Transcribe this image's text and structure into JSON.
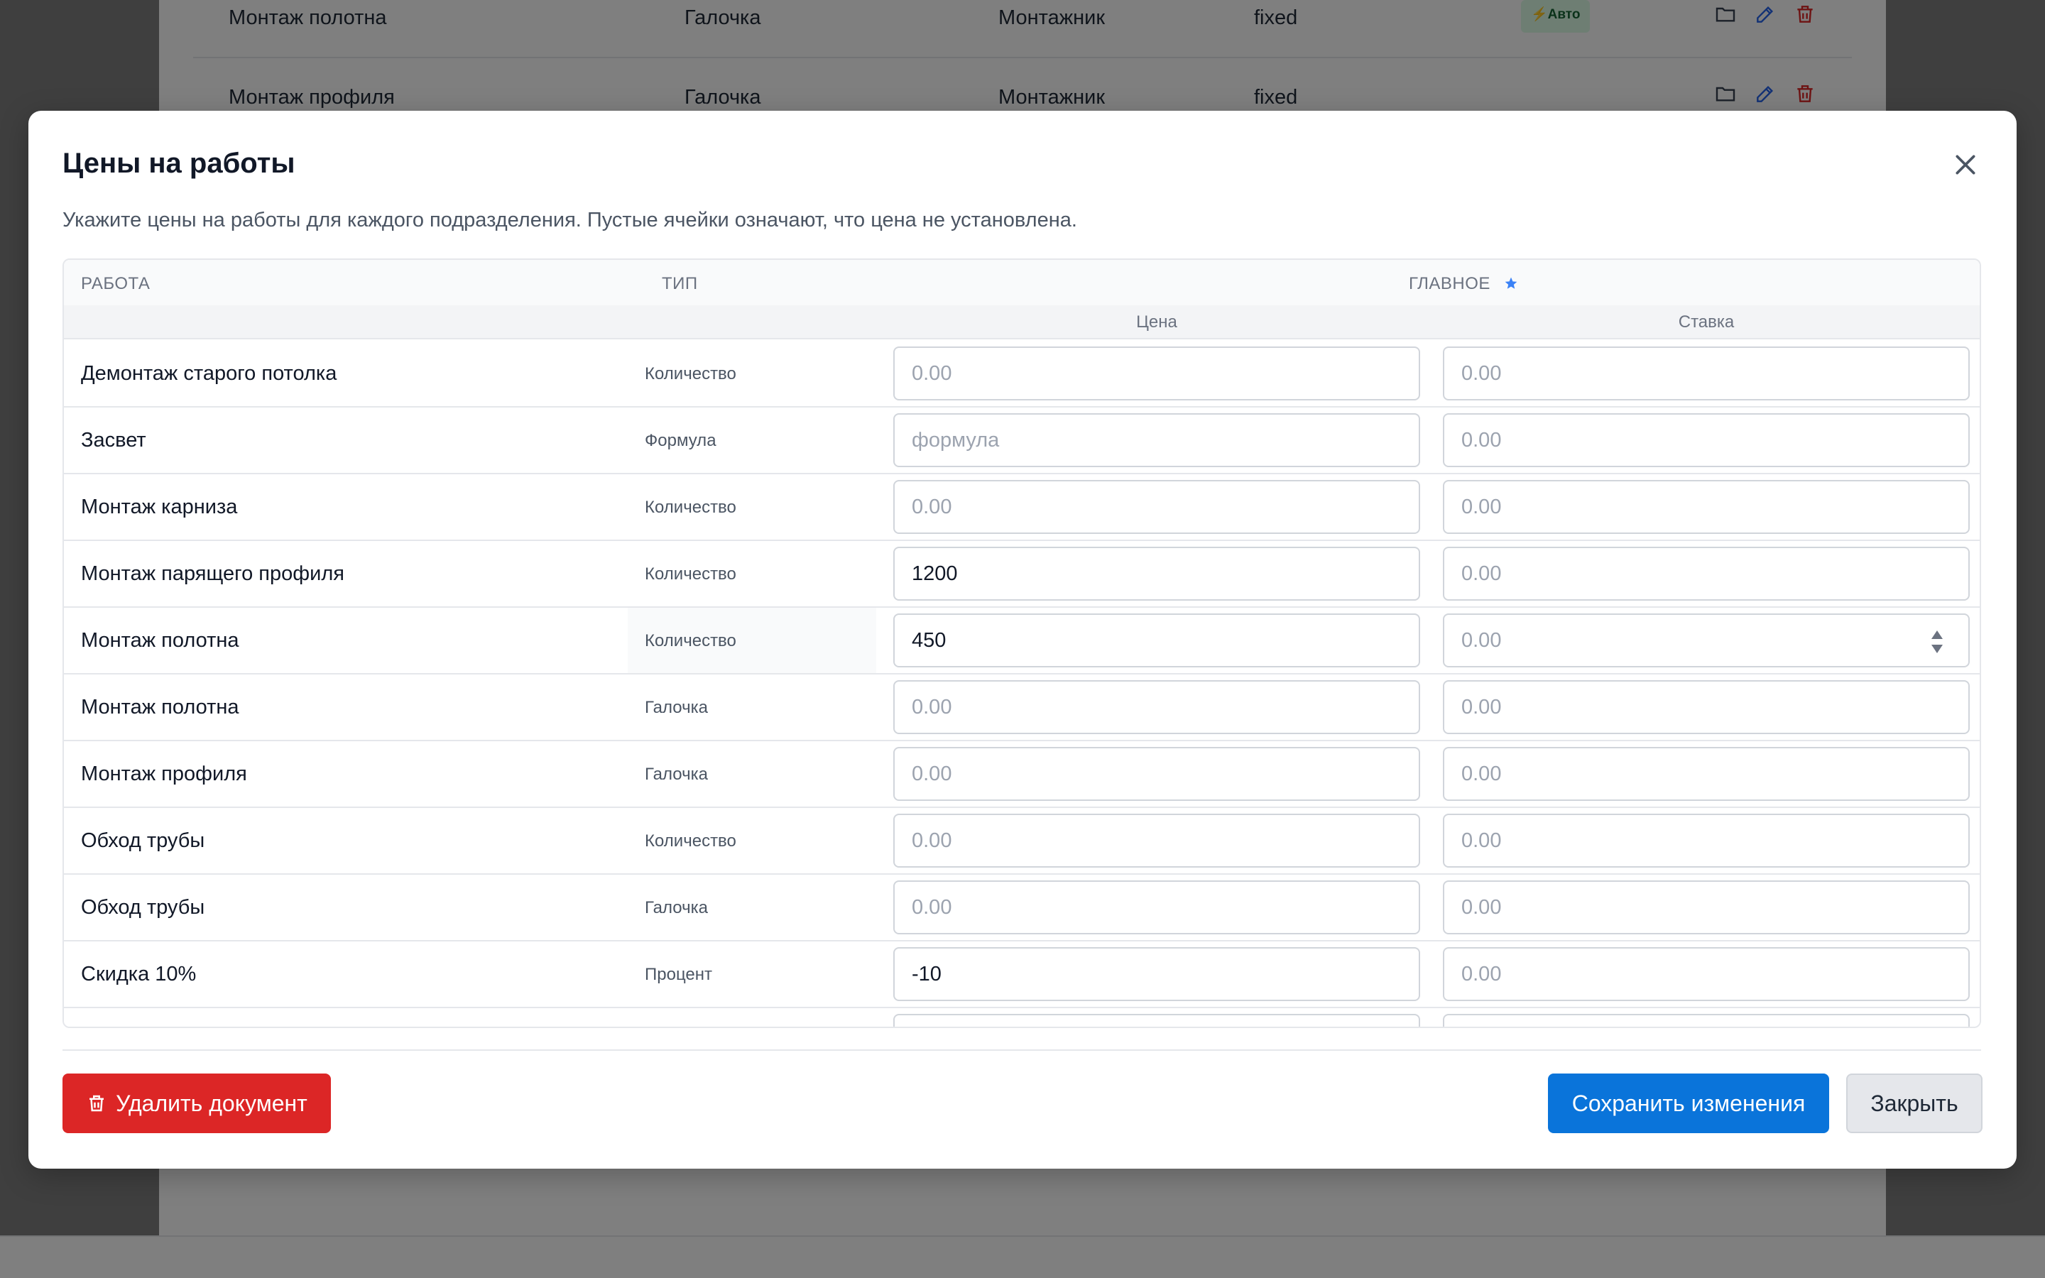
{
  "background_table": {
    "rows": [
      {
        "name": "Монтаж полотна",
        "type": "Галочка",
        "role": "Монтажник",
        "mode": "fixed",
        "badge": "⚡Авто"
      },
      {
        "name": "Монтаж профиля",
        "type": "Галочка",
        "role": "Монтажник",
        "mode": "fixed",
        "badge": ""
      }
    ]
  },
  "modal": {
    "title": "Цены на работы",
    "description": "Укажите цены на работы для каждого подразделения. Пустые ячейки означают, что цена не установлена.",
    "close_icon": "close-icon"
  },
  "table": {
    "headers": {
      "work": "РАБОТА",
      "type": "ТИП",
      "division": "ГЛАВНОЕ",
      "division_icon": "star-icon",
      "price": "Цена",
      "rate": "Ставка"
    },
    "rows": [
      {
        "name": "Демонтаж старого потолка",
        "type": "Количество",
        "price": "",
        "price_placeholder": "0.00",
        "rate": "",
        "rate_placeholder": "0.00"
      },
      {
        "name": "Засвет",
        "type": "Формула",
        "price": "",
        "price_placeholder": "формула",
        "rate": "",
        "rate_placeholder": "0.00"
      },
      {
        "name": "Монтаж карниза",
        "type": "Количество",
        "price": "",
        "price_placeholder": "0.00",
        "rate": "",
        "rate_placeholder": "0.00"
      },
      {
        "name": "Монтаж парящего профиля",
        "type": "Количество",
        "price": "1200",
        "price_placeholder": "0.00",
        "rate": "",
        "rate_placeholder": "0.00"
      },
      {
        "name": "Монтаж полотна",
        "type": "Количество",
        "price": "450",
        "price_placeholder": "0.00",
        "rate": "",
        "rate_placeholder": "0.00"
      },
      {
        "name": "Монтаж полотна",
        "type": "Галочка",
        "price": "",
        "price_placeholder": "0.00",
        "rate": "",
        "rate_placeholder": "0.00"
      },
      {
        "name": "Монтаж профиля",
        "type": "Галочка",
        "price": "",
        "price_placeholder": "0.00",
        "rate": "",
        "rate_placeholder": "0.00"
      },
      {
        "name": "Обход трубы",
        "type": "Количество",
        "price": "",
        "price_placeholder": "0.00",
        "rate": "",
        "rate_placeholder": "0.00"
      },
      {
        "name": "Обход трубы",
        "type": "Галочка",
        "price": "",
        "price_placeholder": "0.00",
        "rate": "",
        "rate_placeholder": "0.00"
      },
      {
        "name": "Скидка 10%",
        "type": "Процент",
        "price": "-10",
        "price_placeholder": "0.00",
        "rate": "",
        "rate_placeholder": "0.00"
      }
    ]
  },
  "footer": {
    "delete_label": "Удалить документ",
    "delete_icon": "trash-icon",
    "save_label": "Сохранить изменения",
    "close_label": "Закрыть"
  },
  "colors": {
    "primary": "#0a74da",
    "danger": "#dc2626",
    "star": "#3b82f6",
    "badge_bg": "#dcfce7"
  }
}
